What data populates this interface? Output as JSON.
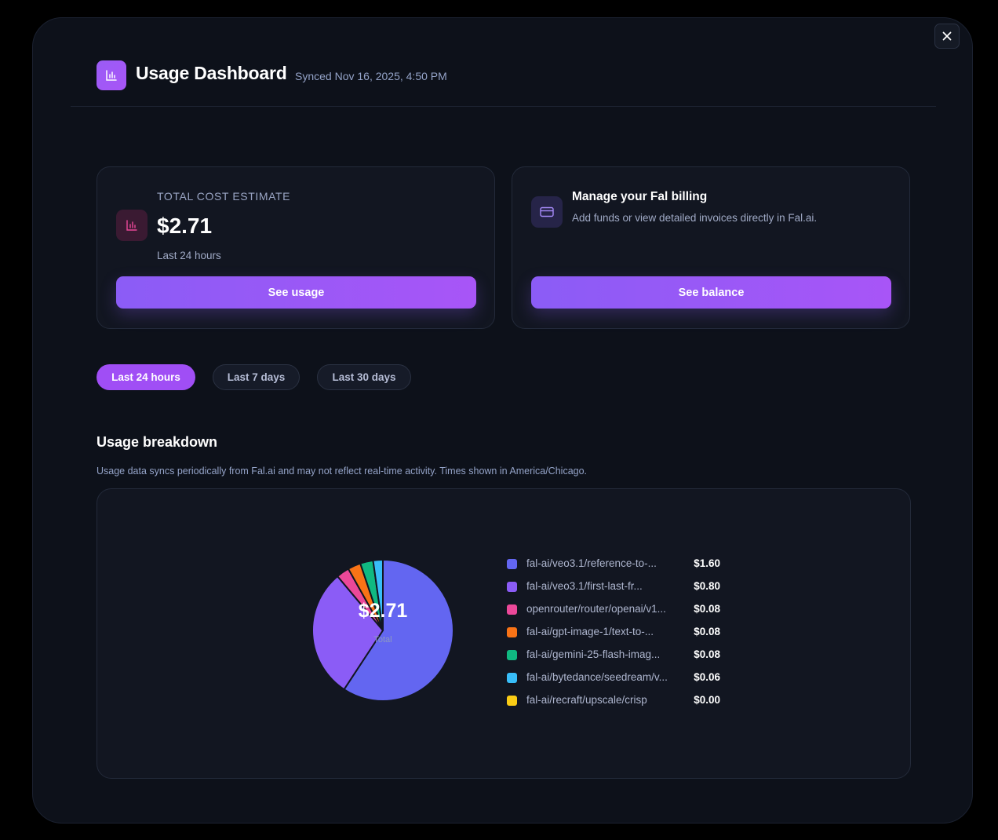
{
  "header": {
    "title": "Usage Dashboard",
    "synced": "Synced Nov 16, 2025, 4:50 PM",
    "icon": "bar-chart-icon",
    "close_icon": "close-icon"
  },
  "cost_card": {
    "label": "TOTAL COST ESTIMATE",
    "value": "$2.71",
    "period": "Last 24 hours",
    "button": "See usage",
    "icon": "bar-chart-icon"
  },
  "billing_card": {
    "title": "Manage your Fal billing",
    "description": "Add funds or view detailed invoices directly in Fal.ai.",
    "button": "See balance",
    "icon": "credit-card-icon"
  },
  "range_tabs": [
    {
      "label": "Last 24 hours",
      "active": true
    },
    {
      "label": "Last 7 days",
      "active": false
    },
    {
      "label": "Last 30 days",
      "active": false
    }
  ],
  "breakdown": {
    "title": "Usage breakdown",
    "note": "Usage data syncs periodically from Fal.ai and may not reflect real-time activity. Times shown in America/Chicago.",
    "total_value": "$2.71",
    "total_label": "Total"
  },
  "colors": {
    "accent": "#a855f7",
    "background": "#0d111a",
    "panel": "#121621"
  },
  "chart_data": {
    "type": "pie",
    "title": "",
    "categories": [
      "fal-ai/veo3.1/reference-to-...",
      "fal-ai/veo3.1/first-last-fr...",
      "openrouter/router/openai/v1...",
      "fal-ai/gpt-image-1/text-to-...",
      "fal-ai/gemini-25-flash-imag...",
      "fal-ai/bytedance/seedream/v...",
      "fal-ai/recraft/upscale/crisp"
    ],
    "values": [
      1.6,
      0.8,
      0.08,
      0.08,
      0.08,
      0.06,
      0.0
    ],
    "value_labels": [
      "$1.60",
      "$0.80",
      "$0.08",
      "$0.08",
      "$0.08",
      "$0.06",
      "$0.00"
    ],
    "colors": [
      "#6366f1",
      "#8b5cf6",
      "#ec4899",
      "#f97316",
      "#10b981",
      "#38bdf8",
      "#facc15"
    ],
    "total": "$2.71",
    "legend_position": "right"
  }
}
